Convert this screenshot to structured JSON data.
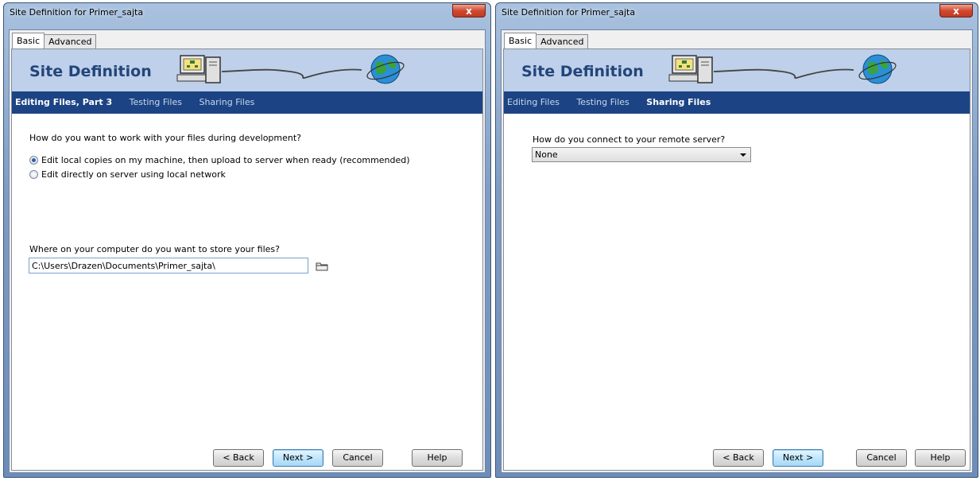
{
  "left_dialog": {
    "title": "Site Definition for Primer_sajta",
    "close_label": "x",
    "tabs": [
      "Basic",
      "Advanced"
    ],
    "banner_title": "Site Definition",
    "nav": [
      "Editing Files, Part 3",
      "Testing Files",
      "Sharing Files"
    ],
    "nav_active": "Editing Files, Part 3",
    "question": "How do you want to work with your files during development?",
    "options": [
      {
        "label": "Edit local copies on my machine, then upload to server when ready (recommended)",
        "selected": true
      },
      {
        "label": "Edit directly on server using local network",
        "selected": false
      }
    ],
    "location_label": "Where on your computer do you want to store your files?",
    "location_value": "C:\\Users\\Drazen\\Documents\\Primer_sajta\\",
    "buttons": {
      "back": "< Back",
      "next": "Next >",
      "cancel": "Cancel",
      "help": "Help"
    }
  },
  "right_dialog": {
    "title": "Site Definition for Primer_sajta",
    "close_label": "x",
    "tabs": [
      "Basic",
      "Advanced"
    ],
    "banner_title": "Site Definition",
    "nav": [
      "Editing Files",
      "Testing Files",
      "Sharing Files"
    ],
    "nav_active": "Sharing Files",
    "question": "How do you connect to your remote server?",
    "connection_value": "None",
    "buttons": {
      "back": "< Back",
      "next": "Next >",
      "cancel": "Cancel",
      "help": "Help"
    }
  },
  "icons": [
    "close-icon",
    "computer-network-icon",
    "globe-icon",
    "folder-icon",
    "dropdown-arrow-icon"
  ]
}
